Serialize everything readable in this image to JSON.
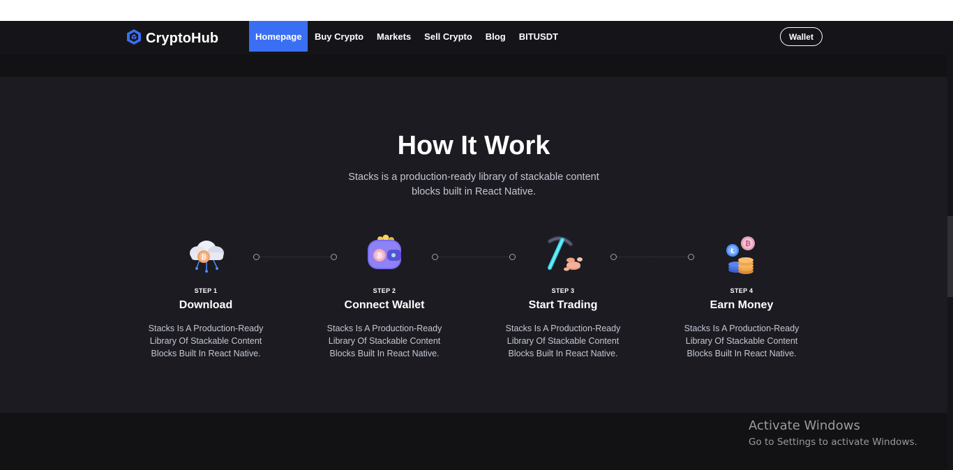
{
  "brand": {
    "name": "CryptoHub",
    "icon": "cube-icon",
    "accent": "#3a6ff4"
  },
  "nav": {
    "items": [
      {
        "label": "Homepage",
        "active": true
      },
      {
        "label": "Buy Crypto",
        "active": false
      },
      {
        "label": "Markets",
        "active": false
      },
      {
        "label": "Sell Crypto",
        "active": false
      },
      {
        "label": "Blog",
        "active": false
      },
      {
        "label": "BITUSDT",
        "active": false
      }
    ],
    "wallet_label": "Wallet"
  },
  "section": {
    "title": "How It Work",
    "subtitle": "Stacks is a production-ready library of stackable content blocks built in React Native."
  },
  "steps": [
    {
      "label": "STEP 1",
      "title": "Download",
      "description": "Stacks Is A Production-Ready Library Of Stackable Content Blocks Built In React Native.",
      "icon": "cloud-bitcoin-icon"
    },
    {
      "label": "STEP 2",
      "title": "Connect Wallet",
      "description": "Stacks Is A Production-Ready Library Of Stackable Content Blocks Built In React Native.",
      "icon": "wallet-icon"
    },
    {
      "label": "STEP 3",
      "title": "Start Trading",
      "description": "Stacks Is A Production-Ready Library Of Stackable Content Blocks Built In React Native.",
      "icon": "pickaxe-icon"
    },
    {
      "label": "STEP 4",
      "title": "Earn Money",
      "description": "Stacks Is A Production-Ready Library Of Stackable Content Blocks Built In React Native.",
      "icon": "coins-stack-icon"
    }
  ],
  "watermark": {
    "title": "Activate Windows",
    "subtitle": "Go to Settings to activate Windows."
  },
  "colors": {
    "background": "#1b1b21",
    "navbar": "#151519",
    "text_muted": "#c4c7d4"
  }
}
